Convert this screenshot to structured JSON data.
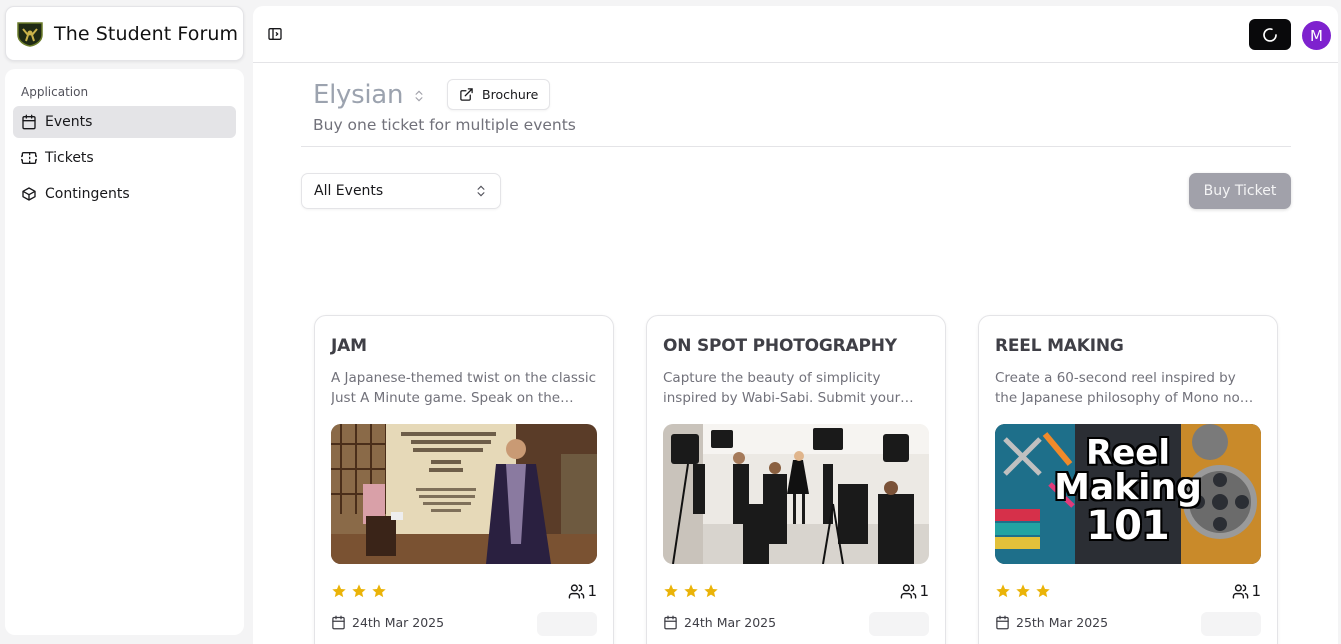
{
  "brand": {
    "name": "The Student Forum",
    "logo_icon": "shield-logo-icon"
  },
  "sidebar": {
    "group_label": "Application",
    "items": [
      {
        "label": "Events",
        "icon": "calendar-icon",
        "active": true
      },
      {
        "label": "Tickets",
        "icon": "ticket-icon",
        "active": false
      },
      {
        "label": "Contingents",
        "icon": "box-icon",
        "active": false
      }
    ]
  },
  "topbar": {
    "toggle_icon": "sidebar-toggle-icon",
    "loader_icon": "spinner-icon",
    "avatar_initial": "M",
    "avatar_color": "#7e22ce"
  },
  "fest": {
    "title": "Elysian",
    "subtitle": "Buy one ticket for multiple events",
    "brochure_label": "Brochure"
  },
  "filter": {
    "selected": "All Events"
  },
  "buy_ticket_label": "Buy Ticket",
  "events": [
    {
      "title": "JAM",
      "description": "A Japanese-themed twist on the classic Just A Minute game. Speak on the topic without hesitation, repetition or deviation.",
      "rating": 3,
      "participants": "1",
      "date": "24th Mar 2025",
      "image_alt": "Speaker in kimono beside a banner"
    },
    {
      "title": "ON SPOT PHOTOGRAPHY",
      "description": "Capture the beauty of simplicity inspired by Wabi-Sabi. Submit your best shots on the spot.",
      "rating": 3,
      "participants": "1",
      "date": "24th Mar 2025",
      "image_alt": "Photographers in a studio"
    },
    {
      "title": "REEL MAKING",
      "description": "Create a 60-second reel inspired by the Japanese philosophy of Mono no aware.",
      "rating": 3,
      "participants": "1",
      "date": "25th Mar 2025",
      "image_alt": "Reel Making 101 poster",
      "image_text": [
        "Reel",
        "Making",
        "101"
      ]
    }
  ],
  "colors": {
    "star": "#eab308",
    "accent": "#09090b",
    "muted": "#71717a"
  }
}
